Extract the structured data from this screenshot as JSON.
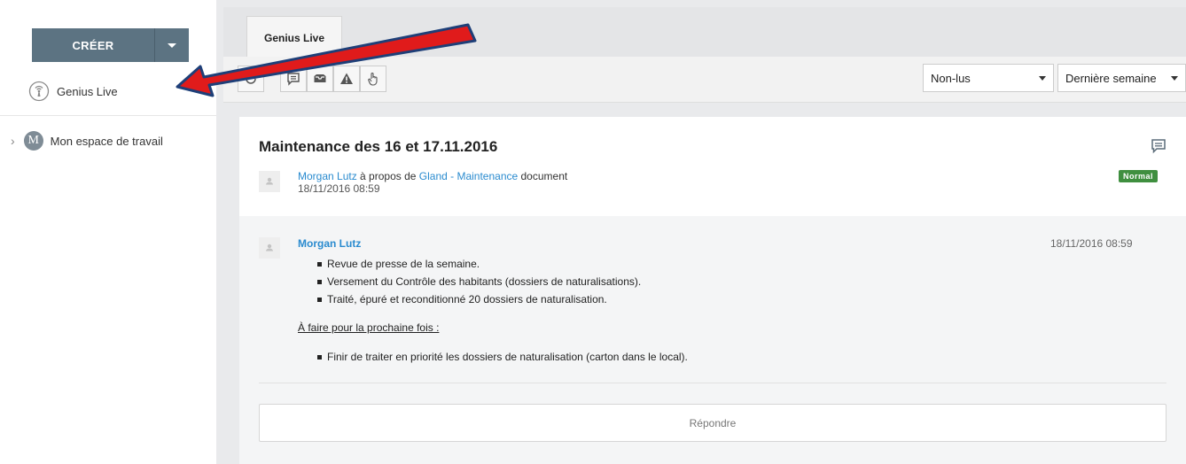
{
  "sidebar": {
    "create_label": "CRÉER",
    "items": [
      {
        "label": "Genius Live",
        "icon": "broadcast-icon"
      },
      {
        "label": "Mon espace de travail",
        "icon": "workspace-avatar",
        "avatar_letter": "M"
      }
    ]
  },
  "tabs": [
    {
      "label": "Genius Live"
    }
  ],
  "toolbar": {
    "filter_label": "Non-lus",
    "period_label": "Dernière semaine",
    "icons": [
      "refresh-icon",
      "comment-icon",
      "inbox-icon",
      "warning-icon",
      "hand-pointer-icon"
    ]
  },
  "post": {
    "title": "Maintenance des 16 et 17.11.2016",
    "author": "Morgan Lutz",
    "about_text": " à propos de ",
    "about_link": "Gland - Maintenance",
    "doc_text": " document",
    "date": "18/11/2016 08:59",
    "priority": "Normal"
  },
  "message": {
    "author": "Morgan Lutz",
    "date": "18/11/2016 08:59",
    "bullets": [
      "Revue de presse de la semaine.",
      "Versement du Contrôle des habitants (dossiers de naturalisations).",
      "Traité, épuré et reconditionné 20 dossiers de naturalisation."
    ],
    "todo_label": "À faire pour la prochaine fois :",
    "todo_bullets": [
      "Finir de traiter en priorité les dossiers de naturalisation (carton dans le local)."
    ]
  },
  "reply_label": "Répondre",
  "colors": {
    "primary_button": "#5c7382",
    "link": "#2a8bcf",
    "priority_badge": "#3f8f3f",
    "arrow_fill": "#e01b1b",
    "arrow_outline": "#1e3f78"
  }
}
